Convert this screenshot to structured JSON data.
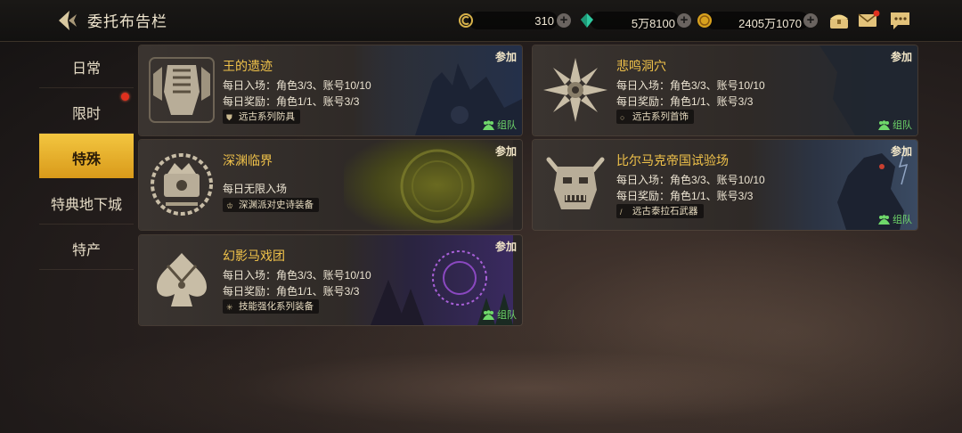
{
  "header": {
    "title": "委托布告栏",
    "currencies": [
      {
        "icon": "coin-c-icon",
        "value": "310"
      },
      {
        "icon": "crystal-icon",
        "value": "5万8100"
      },
      {
        "icon": "gold-coin-icon",
        "value": "2405万1070"
      }
    ],
    "icons": [
      "treasure-box-icon",
      "mail-icon",
      "chat-icon"
    ]
  },
  "sidebar": {
    "items": [
      {
        "label": "日常"
      },
      {
        "label": "限时"
      },
      {
        "label": "特殊"
      },
      {
        "label": "特典地下城"
      },
      {
        "label": "特产"
      }
    ],
    "active": "特殊"
  },
  "cards": [
    {
      "title": "王的遗迹",
      "line1": "每日入场：角色3/3、账号10/10",
      "line2": "每日奖励：角色1/1、账号3/3",
      "reward": "远古系列防具",
      "join": "参加",
      "team": "组队"
    },
    {
      "title": "悲鸣洞穴",
      "line1": "每日入场：角色3/3、账号10/10",
      "line2": "每日奖励：角色1/1、账号3/3",
      "reward": "远古系列首饰",
      "join": "参加",
      "team": "组队"
    },
    {
      "title": "深渊临界",
      "line1": "每日无限入场",
      "reward": "深渊派对史诗装备",
      "join": "参加"
    },
    {
      "title": "比尔马克帝国试验场",
      "line1": "每日入场：角色3/3、账号10/10",
      "line2": "每日奖励：角色1/1、账号3/3",
      "reward": "远古泰拉石武器",
      "join": "参加",
      "team": "组队"
    },
    {
      "title": "幻影马戏团",
      "line1": "每日入场：角色3/3、账号10/10",
      "line2": "每日奖励：角色1/1、账号3/3",
      "reward": "技能强化系列装备",
      "join": "参加",
      "team": "组队"
    }
  ],
  "colors": {
    "accent": "#f0c24a",
    "active_tab": "#e8b030",
    "team_green": "#6fd86a",
    "badge_red": "#e0301e"
  }
}
